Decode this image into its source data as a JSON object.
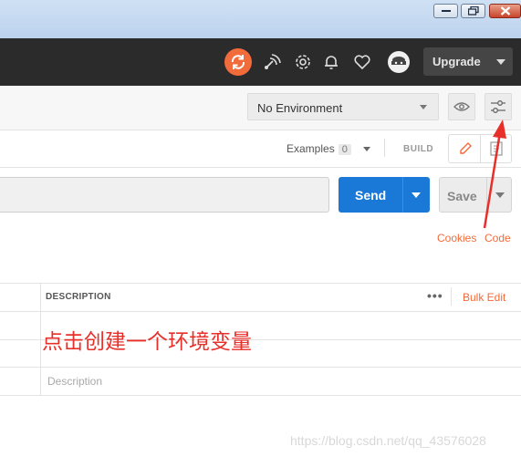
{
  "window": {
    "controls": [
      "minimize",
      "maximize",
      "close"
    ]
  },
  "header": {
    "upgrade_label": "Upgrade",
    "accent": "#f26b3a"
  },
  "environment": {
    "selected": "No Environment"
  },
  "request": {
    "examples_label": "Examples",
    "examples_count": "0",
    "build_label": "BUILD",
    "send_label": "Send",
    "save_label": "Save",
    "cookies_label": "Cookies",
    "code_label": "Code",
    "send_color": "#1a78d6"
  },
  "params_table": {
    "description_header": "DESCRIPTION",
    "more_label": "•••",
    "bulk_edit_label": "Bulk Edit",
    "description_placeholder": "Description"
  },
  "annotation": {
    "text": "点击创建一个环境变量",
    "color": "#e8302b"
  },
  "watermark": "https://blog.csdn.net/qq_43576028"
}
